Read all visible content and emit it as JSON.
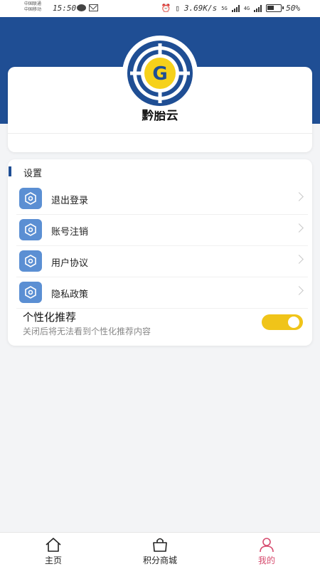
{
  "status_bar": {
    "carrier_1": "中国联通",
    "carrier_2": "中国移动",
    "time": "15:50",
    "net_speed": "3.69K/s",
    "net_5g": "5G",
    "net_4g": "4G",
    "battery": "50%"
  },
  "profile": {
    "app_name": "黔胎云",
    "logo_letter": "G"
  },
  "settings": {
    "section_title": "设置",
    "items": [
      {
        "label": "退出登录",
        "icon": "gear-icon"
      },
      {
        "label": "账号注销",
        "icon": "gear-icon"
      },
      {
        "label": "用户协议",
        "icon": "gear-icon"
      },
      {
        "label": "隐私政策",
        "icon": "gear-icon"
      }
    ],
    "personalized": {
      "title": "个性化推荐",
      "description": "关闭后将无法看到个性化推荐内容",
      "enabled": true
    }
  },
  "bottom_nav": {
    "items": [
      {
        "label": "主页",
        "icon": "home-icon",
        "active": false
      },
      {
        "label": "积分商城",
        "icon": "shopping-bag-icon",
        "active": false
      },
      {
        "label": "我的",
        "icon": "user-icon",
        "active": true
      }
    ]
  },
  "colors": {
    "header_blue": "#1f4e94",
    "menu_icon_blue": "#5b8fd3",
    "toggle_yellow": "#f0c419",
    "active_nav": "#d64b6e",
    "logo_yellow": "#f6d11a"
  }
}
